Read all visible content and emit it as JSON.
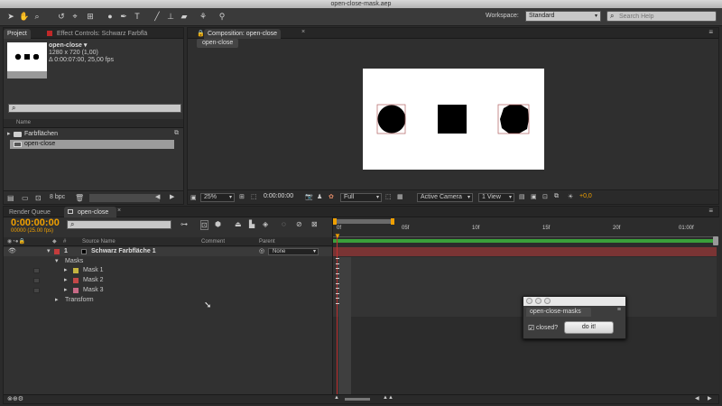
{
  "window_title": "open-close-mask.aep",
  "workspace": {
    "label": "Workspace:",
    "value": "Standard"
  },
  "search_help": {
    "placeholder": "Search Help"
  },
  "project_panel": {
    "tabs": [
      "Project",
      "Effect Controls: Schwarz Farbflä"
    ],
    "comp_name": "open-close ▾",
    "comp_size": "1280 x 720 (1,00)",
    "comp_duration": "Δ 0:00:07:00, 25,00 fps",
    "search_value": "",
    "name_header": "Name",
    "items": [
      {
        "name": "Farbflächen",
        "type": "folder"
      },
      {
        "name": "open-close",
        "type": "comp"
      }
    ],
    "bpc": "8 bpc"
  },
  "composition_panel": {
    "tab": "Composition: open-close",
    "subtab": "open-close",
    "zoom": "25%",
    "timecode": "0:00:00:00",
    "resolution": "Full",
    "camera": "Active Camera",
    "views": "1 View",
    "exposure": "+0,0"
  },
  "timeline_panel": {
    "tabs": [
      "Render Queue",
      "open-close"
    ],
    "timecode": "0:00:00:00",
    "frames": "00000 (25.00 fps)",
    "columns": {
      "num": "#",
      "source": "Source Name",
      "comment": "Comment",
      "parent": "Parent"
    },
    "ruler": [
      "0f",
      "05f",
      "10f",
      "15f",
      "20f",
      "01:00f"
    ],
    "layers": [
      {
        "index": "1",
        "name": "Schwarz Farbfläche 1",
        "parent": "None",
        "color": "#c43c3c"
      }
    ],
    "masks_label": "Masks",
    "masks": [
      {
        "name": "Mask 1",
        "color": "#c4b440"
      },
      {
        "name": "Mask 2",
        "color": "#c44848"
      },
      {
        "name": "Mask 3",
        "color": "#c86a86"
      }
    ],
    "transform_label": "Transform"
  },
  "dialog": {
    "title": "open-close-masks",
    "checkbox_label": "closed?",
    "checkbox_checked": true,
    "button_label": "do it!"
  },
  "colors": {
    "accent": "#f0a000",
    "panel": "#333333",
    "layer_bar": "#7a3434"
  }
}
